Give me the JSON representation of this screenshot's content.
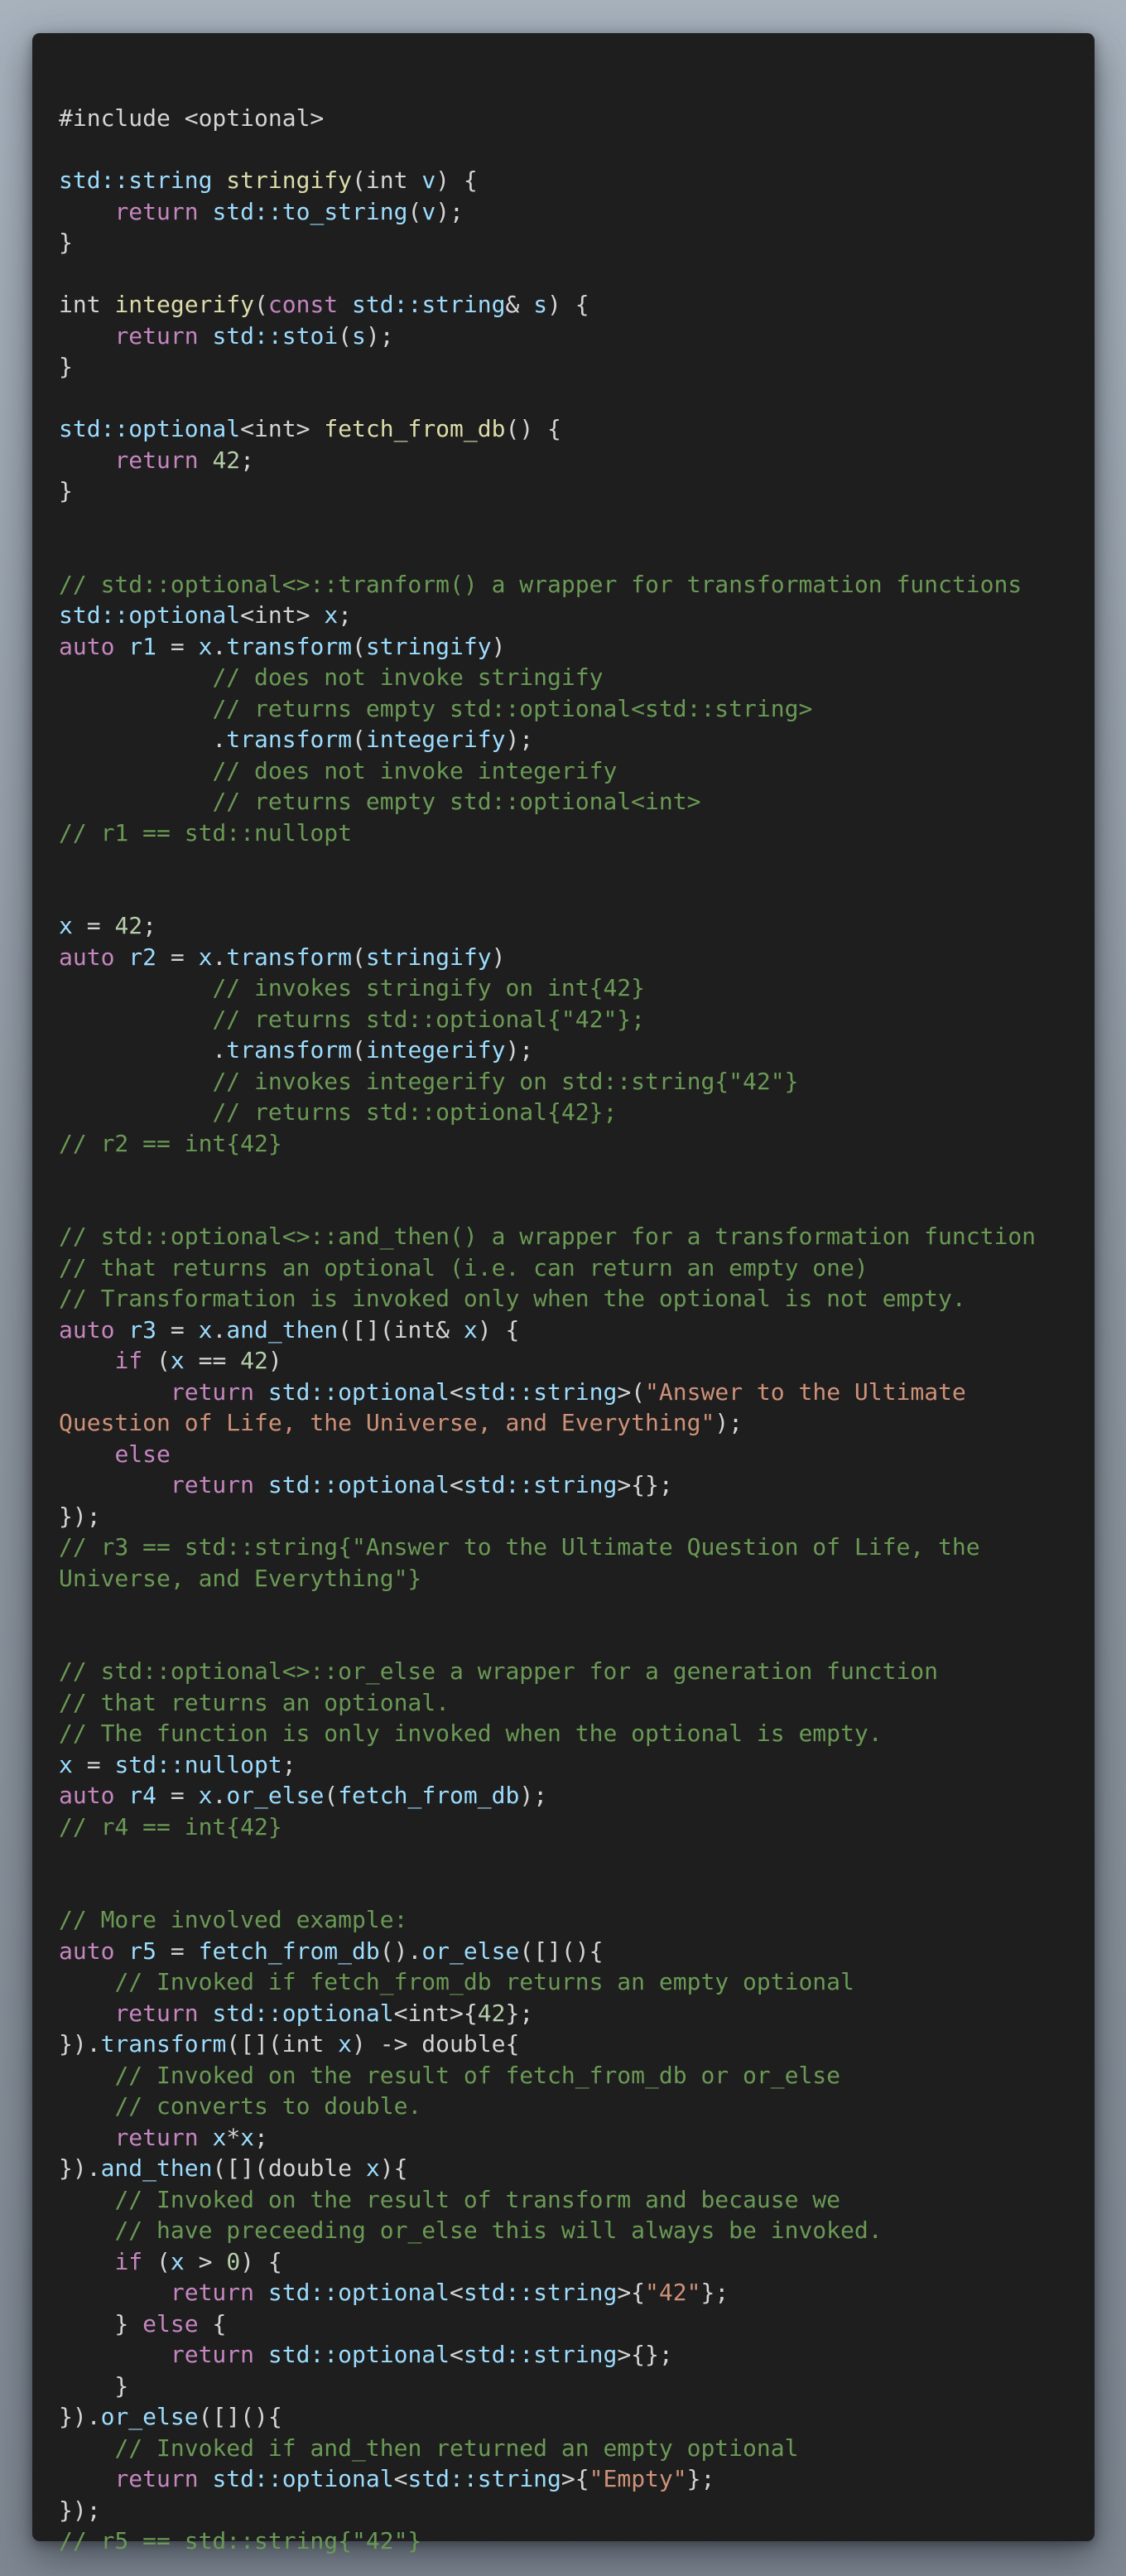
{
  "colors": {
    "background": "#1e1e1e",
    "plain": "#d4d4d4",
    "keyword": "#c586c0",
    "identifier": "#9cdcfe",
    "function": "#dcdcaa",
    "comment": "#6a9955",
    "string": "#ce9178",
    "number": "#b5cea8"
  },
  "code": {
    "language": "cpp",
    "lines": [
      [
        [
          "p",
          "#include <optional>"
        ]
      ],
      [],
      [
        [
          "t",
          "std::string"
        ],
        [
          "p",
          " "
        ],
        [
          "f",
          "stringify"
        ],
        [
          "p",
          "(int "
        ],
        [
          "t",
          "v"
        ],
        [
          "p",
          ") {"
        ]
      ],
      [
        [
          "p",
          "    "
        ],
        [
          "k",
          "return"
        ],
        [
          "p",
          " "
        ],
        [
          "t",
          "std::to_string"
        ],
        [
          "p",
          "("
        ],
        [
          "t",
          "v"
        ],
        [
          "p",
          ");"
        ]
      ],
      [
        [
          "p",
          "}"
        ]
      ],
      [],
      [
        [
          "p",
          "int "
        ],
        [
          "f",
          "integerify"
        ],
        [
          "p",
          "("
        ],
        [
          "k",
          "const"
        ],
        [
          "p",
          " "
        ],
        [
          "t",
          "std::string"
        ],
        [
          "p",
          "& "
        ],
        [
          "t",
          "s"
        ],
        [
          "p",
          ") {"
        ]
      ],
      [
        [
          "p",
          "    "
        ],
        [
          "k",
          "return"
        ],
        [
          "p",
          " "
        ],
        [
          "t",
          "std::stoi"
        ],
        [
          "p",
          "("
        ],
        [
          "t",
          "s"
        ],
        [
          "p",
          ");"
        ]
      ],
      [
        [
          "p",
          "}"
        ]
      ],
      [],
      [
        [
          "t",
          "std::optional"
        ],
        [
          "p",
          "<int> "
        ],
        [
          "f",
          "fetch_from_db"
        ],
        [
          "p",
          "() {"
        ]
      ],
      [
        [
          "p",
          "    "
        ],
        [
          "k",
          "return"
        ],
        [
          "p",
          " "
        ],
        [
          "n",
          "42"
        ],
        [
          "p",
          ";"
        ]
      ],
      [
        [
          "p",
          "}"
        ]
      ],
      [],
      [],
      [
        [
          "c",
          "// std::optional<>::tranform() a wrapper for transformation functions"
        ]
      ],
      [
        [
          "t",
          "std::optional"
        ],
        [
          "p",
          "<int> "
        ],
        [
          "t",
          "x"
        ],
        [
          "p",
          ";"
        ]
      ],
      [
        [
          "k",
          "auto"
        ],
        [
          "p",
          " "
        ],
        [
          "t",
          "r1"
        ],
        [
          "p",
          " = "
        ],
        [
          "t",
          "x"
        ],
        [
          "p",
          "."
        ],
        [
          "t",
          "transform"
        ],
        [
          "p",
          "("
        ],
        [
          "t",
          "stringify"
        ],
        [
          "p",
          ")"
        ]
      ],
      [
        [
          "p",
          "           "
        ],
        [
          "c",
          "// does not invoke stringify"
        ]
      ],
      [
        [
          "p",
          "           "
        ],
        [
          "c",
          "// returns empty std::optional<std::string>"
        ]
      ],
      [
        [
          "p",
          "           ."
        ],
        [
          "t",
          "transform"
        ],
        [
          "p",
          "("
        ],
        [
          "t",
          "integerify"
        ],
        [
          "p",
          ");"
        ]
      ],
      [
        [
          "p",
          "           "
        ],
        [
          "c",
          "// does not invoke integerify"
        ]
      ],
      [
        [
          "p",
          "           "
        ],
        [
          "c",
          "// returns empty std::optional<int>"
        ]
      ],
      [
        [
          "c",
          "// r1 == std::nullopt"
        ]
      ],
      [],
      [],
      [
        [
          "t",
          "x"
        ],
        [
          "p",
          " = "
        ],
        [
          "n",
          "42"
        ],
        [
          "p",
          ";"
        ]
      ],
      [
        [
          "k",
          "auto"
        ],
        [
          "p",
          " "
        ],
        [
          "t",
          "r2"
        ],
        [
          "p",
          " = "
        ],
        [
          "t",
          "x"
        ],
        [
          "p",
          "."
        ],
        [
          "t",
          "transform"
        ],
        [
          "p",
          "("
        ],
        [
          "t",
          "stringify"
        ],
        [
          "p",
          ")"
        ]
      ],
      [
        [
          "p",
          "           "
        ],
        [
          "c",
          "// invokes stringify on int{42}"
        ]
      ],
      [
        [
          "p",
          "           "
        ],
        [
          "c",
          "// returns std::optional{\"42\"};"
        ]
      ],
      [
        [
          "p",
          "           ."
        ],
        [
          "t",
          "transform"
        ],
        [
          "p",
          "("
        ],
        [
          "t",
          "integerify"
        ],
        [
          "p",
          ");"
        ]
      ],
      [
        [
          "p",
          "           "
        ],
        [
          "c",
          "// invokes integerify on std::string{\"42\"}"
        ]
      ],
      [
        [
          "p",
          "           "
        ],
        [
          "c",
          "// returns std::optional{42};"
        ]
      ],
      [
        [
          "c",
          "// r2 == int{42}"
        ]
      ],
      [],
      [],
      [
        [
          "c",
          "// std::optional<>::and_then() a wrapper for a transformation function"
        ]
      ],
      [
        [
          "c",
          "// that returns an optional (i.e. can return an empty one)"
        ]
      ],
      [
        [
          "c",
          "// Transformation is invoked only when the optional is not empty."
        ]
      ],
      [
        [
          "k",
          "auto"
        ],
        [
          "p",
          " "
        ],
        [
          "t",
          "r3"
        ],
        [
          "p",
          " = "
        ],
        [
          "t",
          "x"
        ],
        [
          "p",
          "."
        ],
        [
          "t",
          "and_then"
        ],
        [
          "p",
          "([](int& "
        ],
        [
          "t",
          "x"
        ],
        [
          "p",
          ") {"
        ]
      ],
      [
        [
          "p",
          "    "
        ],
        [
          "k",
          "if"
        ],
        [
          "p",
          " ("
        ],
        [
          "t",
          "x"
        ],
        [
          "p",
          " == "
        ],
        [
          "n",
          "42"
        ],
        [
          "p",
          ")"
        ]
      ],
      [
        [
          "p",
          "        "
        ],
        [
          "k",
          "return"
        ],
        [
          "p",
          " "
        ],
        [
          "t",
          "std::optional"
        ],
        [
          "p",
          "<"
        ],
        [
          "t",
          "std::string"
        ],
        [
          "p",
          ">("
        ],
        [
          "s",
          "\"Answer to the Ultimate"
        ]
      ],
      [
        [
          "s",
          "Question of Life, the Universe, and Everything\""
        ],
        [
          "p",
          ");"
        ]
      ],
      [
        [
          "p",
          "    "
        ],
        [
          "k",
          "else"
        ]
      ],
      [
        [
          "p",
          "        "
        ],
        [
          "k",
          "return"
        ],
        [
          "p",
          " "
        ],
        [
          "t",
          "std::optional"
        ],
        [
          "p",
          "<"
        ],
        [
          "t",
          "std::string"
        ],
        [
          "p",
          ">{};"
        ]
      ],
      [
        [
          "p",
          "});"
        ]
      ],
      [
        [
          "c",
          "// r3 == std::string{\"Answer to the Ultimate Question of Life, the"
        ]
      ],
      [
        [
          "c",
          "Universe, and Everything\"}"
        ]
      ],
      [],
      [],
      [
        [
          "c",
          "// std::optional<>::or_else a wrapper for a generation function"
        ]
      ],
      [
        [
          "c",
          "// that returns an optional."
        ]
      ],
      [
        [
          "c",
          "// The function is only invoked when the optional is empty."
        ]
      ],
      [
        [
          "t",
          "x"
        ],
        [
          "p",
          " = "
        ],
        [
          "t",
          "std::nullopt"
        ],
        [
          "p",
          ";"
        ]
      ],
      [
        [
          "k",
          "auto"
        ],
        [
          "p",
          " "
        ],
        [
          "t",
          "r4"
        ],
        [
          "p",
          " = "
        ],
        [
          "t",
          "x"
        ],
        [
          "p",
          "."
        ],
        [
          "t",
          "or_else"
        ],
        [
          "p",
          "("
        ],
        [
          "t",
          "fetch_from_db"
        ],
        [
          "p",
          ");"
        ]
      ],
      [
        [
          "c",
          "// r4 == int{42}"
        ]
      ],
      [],
      [],
      [
        [
          "c",
          "// More involved example:"
        ]
      ],
      [
        [
          "k",
          "auto"
        ],
        [
          "p",
          " "
        ],
        [
          "t",
          "r5"
        ],
        [
          "p",
          " = "
        ],
        [
          "t",
          "fetch_from_db"
        ],
        [
          "p",
          "()."
        ],
        [
          "t",
          "or_else"
        ],
        [
          "p",
          "([](){"
        ]
      ],
      [
        [
          "p",
          "    "
        ],
        [
          "c",
          "// Invoked if fetch_from_db returns an empty optional"
        ]
      ],
      [
        [
          "p",
          "    "
        ],
        [
          "k",
          "return"
        ],
        [
          "p",
          " "
        ],
        [
          "t",
          "std::optional"
        ],
        [
          "p",
          "<int>{"
        ],
        [
          "n",
          "42"
        ],
        [
          "p",
          "};"
        ]
      ],
      [
        [
          "p",
          "})."
        ],
        [
          "t",
          "transform"
        ],
        [
          "p",
          "([](int "
        ],
        [
          "t",
          "x"
        ],
        [
          "p",
          ") -> double{"
        ]
      ],
      [
        [
          "p",
          "    "
        ],
        [
          "c",
          "// Invoked on the result of fetch_from_db or or_else"
        ]
      ],
      [
        [
          "p",
          "    "
        ],
        [
          "c",
          "// converts to double."
        ]
      ],
      [
        [
          "p",
          "    "
        ],
        [
          "k",
          "return"
        ],
        [
          "p",
          " "
        ],
        [
          "t",
          "x"
        ],
        [
          "p",
          "*"
        ],
        [
          "t",
          "x"
        ],
        [
          "p",
          ";"
        ]
      ],
      [
        [
          "p",
          "})."
        ],
        [
          "t",
          "and_then"
        ],
        [
          "p",
          "([](double "
        ],
        [
          "t",
          "x"
        ],
        [
          "p",
          "){"
        ]
      ],
      [
        [
          "p",
          "    "
        ],
        [
          "c",
          "// Invoked on the result of transform and because we"
        ]
      ],
      [
        [
          "p",
          "    "
        ],
        [
          "c",
          "// have preceeding or_else this will always be invoked."
        ]
      ],
      [
        [
          "p",
          "    "
        ],
        [
          "k",
          "if"
        ],
        [
          "p",
          " ("
        ],
        [
          "t",
          "x"
        ],
        [
          "p",
          " > "
        ],
        [
          "n",
          "0"
        ],
        [
          "p",
          ") {"
        ]
      ],
      [
        [
          "p",
          "        "
        ],
        [
          "k",
          "return"
        ],
        [
          "p",
          " "
        ],
        [
          "t",
          "std::optional"
        ],
        [
          "p",
          "<"
        ],
        [
          "t",
          "std::string"
        ],
        [
          "p",
          ">{"
        ],
        [
          "s",
          "\"42\""
        ],
        [
          "p",
          "};"
        ]
      ],
      [
        [
          "p",
          "    } "
        ],
        [
          "k",
          "else"
        ],
        [
          "p",
          " {"
        ]
      ],
      [
        [
          "p",
          "        "
        ],
        [
          "k",
          "return"
        ],
        [
          "p",
          " "
        ],
        [
          "t",
          "std::optional"
        ],
        [
          "p",
          "<"
        ],
        [
          "t",
          "std::string"
        ],
        [
          "p",
          ">{};"
        ]
      ],
      [
        [
          "p",
          "    }"
        ]
      ],
      [
        [
          "p",
          "})."
        ],
        [
          "t",
          "or_else"
        ],
        [
          "p",
          "([](){"
        ]
      ],
      [
        [
          "p",
          "    "
        ],
        [
          "c",
          "// Invoked if and_then returned an empty optional"
        ]
      ],
      [
        [
          "p",
          "    "
        ],
        [
          "k",
          "return"
        ],
        [
          "p",
          " "
        ],
        [
          "t",
          "std::optional"
        ],
        [
          "p",
          "<"
        ],
        [
          "t",
          "std::string"
        ],
        [
          "p",
          ">{"
        ],
        [
          "s",
          "\"Empty\""
        ],
        [
          "p",
          "};"
        ]
      ],
      [
        [
          "p",
          "});"
        ]
      ],
      [
        [
          "c",
          "// r5 == std::string{\"42\"}"
        ]
      ]
    ]
  }
}
